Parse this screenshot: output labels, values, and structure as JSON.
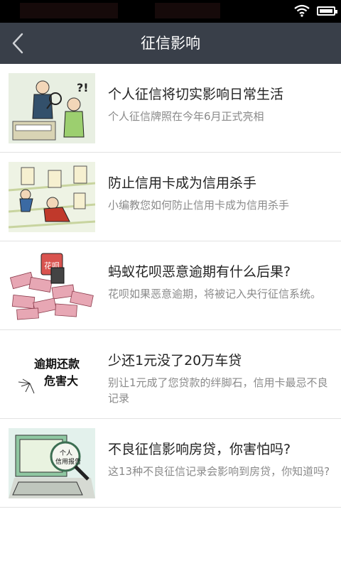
{
  "nav": {
    "title": "征信影响"
  },
  "items": [
    {
      "title": "个人征信将切实影响日常生活",
      "subtitle": "个人征信牌照在今年6月正式亮相",
      "thumb_icon": "credit-inspection-cartoon"
    },
    {
      "title": "防止信用卡成为信用杀手",
      "subtitle": "小编教您如何防止信用卡成为信用杀手",
      "thumb_icon": "credit-card-killer-cartoon"
    },
    {
      "title": "蚂蚁花呗恶意逾期有什么后果?",
      "subtitle": "花呗如果恶意逾期，将被记入央行征信系统。",
      "thumb_icon": "huabei-cash-cartoon",
      "thumb_text": "花呗"
    },
    {
      "title": "少还1元没了20万车贷",
      "subtitle": "别让1元成了您贷款的绊脚石，信用卡最忌不良记录",
      "thumb_icon": "overdue-warning",
      "thumb_text_1": "逾期还款",
      "thumb_text_2": "危害大"
    },
    {
      "title": "不良征信影响房贷，你害怕吗?",
      "subtitle": "这13种不良征信记录会影响到房贷，你知道吗?",
      "thumb_icon": "credit-report-computer",
      "thumb_text_1": "个人",
      "thumb_text_2": "信用报告"
    }
  ],
  "colors": {
    "navbar": "#393f49",
    "statusbar": "#000000",
    "divider": "#e2e2e2"
  }
}
